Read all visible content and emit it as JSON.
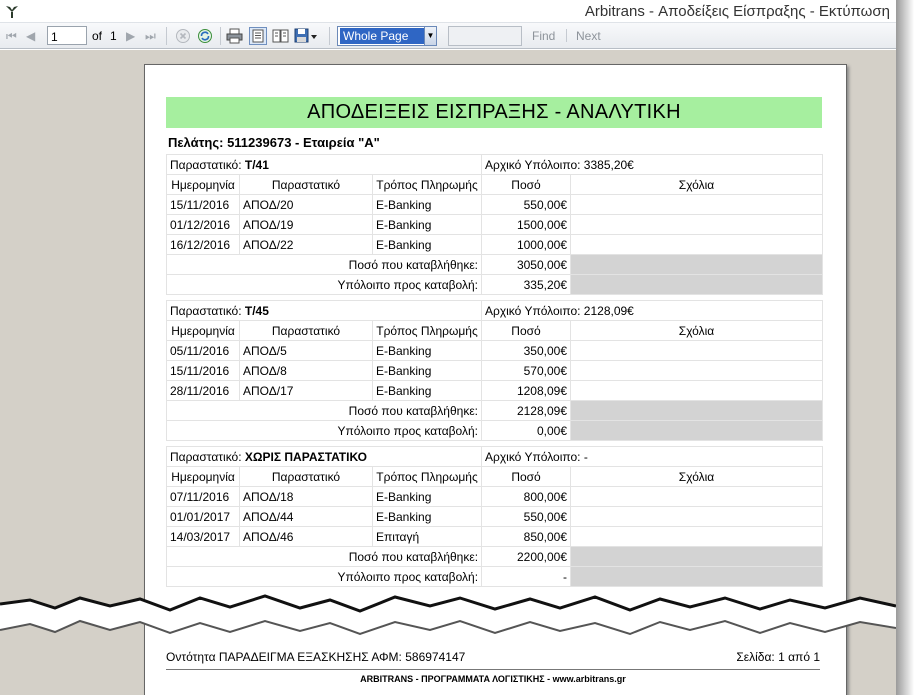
{
  "window": {
    "title": "Arbitrans - Αποδείξεις Είσπραξης - Εκτύπωση"
  },
  "toolbar": {
    "page_value": "1",
    "of_label": "of",
    "page_total": "1",
    "zoom_value": "Whole Page",
    "find_label": "Find",
    "next_label": "Next"
  },
  "report": {
    "title": "ΑΠΟΔΕΙΞΕΙΣ ΕΙΣΠΡΑΞΗΣ - ΑΝΑΛΥΤΙΚΗ",
    "customer": "Πελάτης: 511239673 - Εταιρεία \"Α\"",
    "invoice_label": "Παραστατικό: ",
    "balance_label": "Αρχικό Υπόλοιπο: ",
    "columns": [
      "Ημερομηνία",
      "Παραστατικό",
      "Τρόπος Πληρωμής",
      "Ποσό",
      "Σχόλια"
    ],
    "paid_label": "Ποσό που καταβλήθηκε:",
    "remaining_label": "Υπόλοιπο προς καταβολή:",
    "groups": [
      {
        "invoice": "Τ/41",
        "balance": "3385,20€",
        "rows": [
          [
            "15/11/2016",
            "ΑΠΟΔ/20",
            "E-Banking",
            "550,00€",
            ""
          ],
          [
            "01/12/2016",
            "ΑΠΟΔ/19",
            "E-Banking",
            "1500,00€",
            ""
          ],
          [
            "16/12/2016",
            "ΑΠΟΔ/22",
            "E-Banking",
            "1000,00€",
            ""
          ]
        ],
        "paid": "3050,00€",
        "remaining": "335,20€"
      },
      {
        "invoice": "Τ/45",
        "balance": "2128,09€",
        "rows": [
          [
            "05/11/2016",
            "ΑΠΟΔ/5",
            "E-Banking",
            "350,00€",
            ""
          ],
          [
            "15/11/2016",
            "ΑΠΟΔ/8",
            "E-Banking",
            "570,00€",
            ""
          ],
          [
            "28/11/2016",
            "ΑΠΟΔ/17",
            "E-Banking",
            "1208,09€",
            ""
          ]
        ],
        "paid": "2128,09€",
        "remaining": "0,00€"
      },
      {
        "invoice": "ΧΩΡΙΣ ΠΑΡΑΣΤΑΤΙΚΟ",
        "balance": "-",
        "rows": [
          [
            "07/11/2016",
            "ΑΠΟΔ/18",
            "E-Banking",
            "800,00€",
            ""
          ],
          [
            "01/01/2017",
            "ΑΠΟΔ/44",
            "E-Banking",
            "550,00€",
            ""
          ],
          [
            "14/03/2017",
            "ΑΠΟΔ/46",
            "Επιταγή",
            "850,00€",
            ""
          ]
        ],
        "paid": "2200,00€",
        "remaining": "-"
      }
    ]
  },
  "footer": {
    "entity": "Οντότητα ΠΑΡΑΔΕΙΓΜΑ ΕΞΑΣΚΗΣΗΣ   ΑΦΜ: 586974147",
    "page": "Σελίδα: 1 από 1",
    "credits": "ARBITRANS - ΠΡΟΓΡΑΜΜΑΤΑ ΛΟΓΙΣΤΙΚΗΣ - www.arbitrans.gr"
  }
}
